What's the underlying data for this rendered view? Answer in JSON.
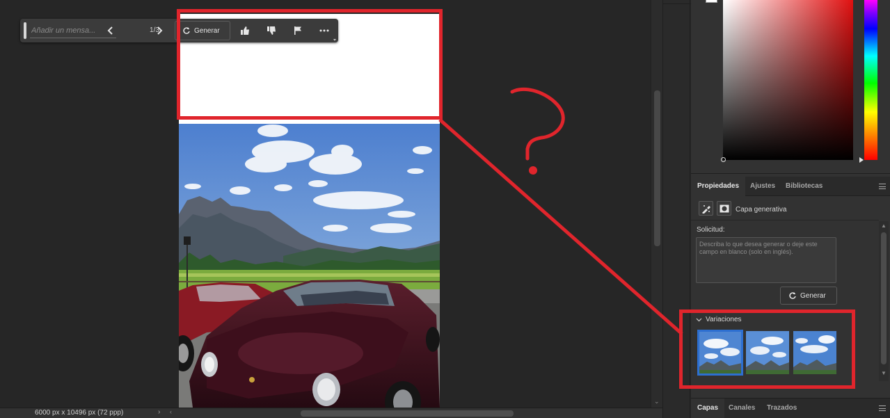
{
  "taskbar": {
    "input_placeholder": "Añadir un mensa...",
    "counter": "1/3",
    "generate_label": "Generar"
  },
  "status": {
    "document_info": "6000 px x 10496 px (72 ppp)"
  },
  "properties_panel": {
    "tabs": [
      "Propiedades",
      "Ajustes",
      "Bibliotecas"
    ],
    "active_tab": "Propiedades",
    "layer_name": "Capa generativa",
    "prompt_label": "Solicitud:",
    "prompt_placeholder": "Describa lo que desea generar o deje este campo en blanco (solo en inglés).",
    "generate_label": "Generar",
    "variations_label": "Variaciones",
    "variations_count": 3,
    "selected_variation": 1
  },
  "layers_panel": {
    "tabs": [
      "Capas",
      "Canales",
      "Trazados"
    ],
    "active_tab": "Capas"
  },
  "colors": {
    "annotation_red": "#e0252c",
    "selection_blue": "#2d6fd1",
    "panel_bg": "#323232",
    "canvas_bg": "#262626"
  }
}
